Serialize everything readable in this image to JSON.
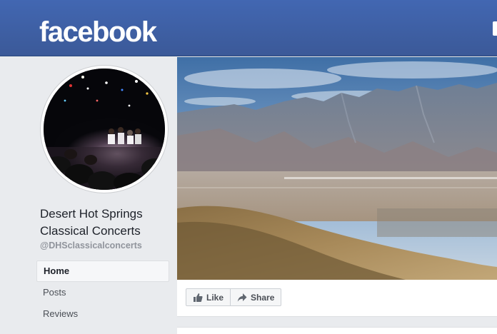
{
  "header": {
    "logo_text": "facebook"
  },
  "profile": {
    "name_line1": "Desert Hot Springs",
    "name_line2": "Classical Concerts",
    "handle": "@DHSclassicalconcerts",
    "avatar_desc_icon": "concert-photo"
  },
  "nav": {
    "items": [
      {
        "label": "Home",
        "active": true
      },
      {
        "label": "Posts",
        "active": false
      },
      {
        "label": "Reviews",
        "active": false
      }
    ]
  },
  "actions": {
    "like_label": "Like",
    "share_label": "Share"
  },
  "colors": {
    "brand_blue": "#4267b2",
    "page_bg": "#e9ebee"
  }
}
